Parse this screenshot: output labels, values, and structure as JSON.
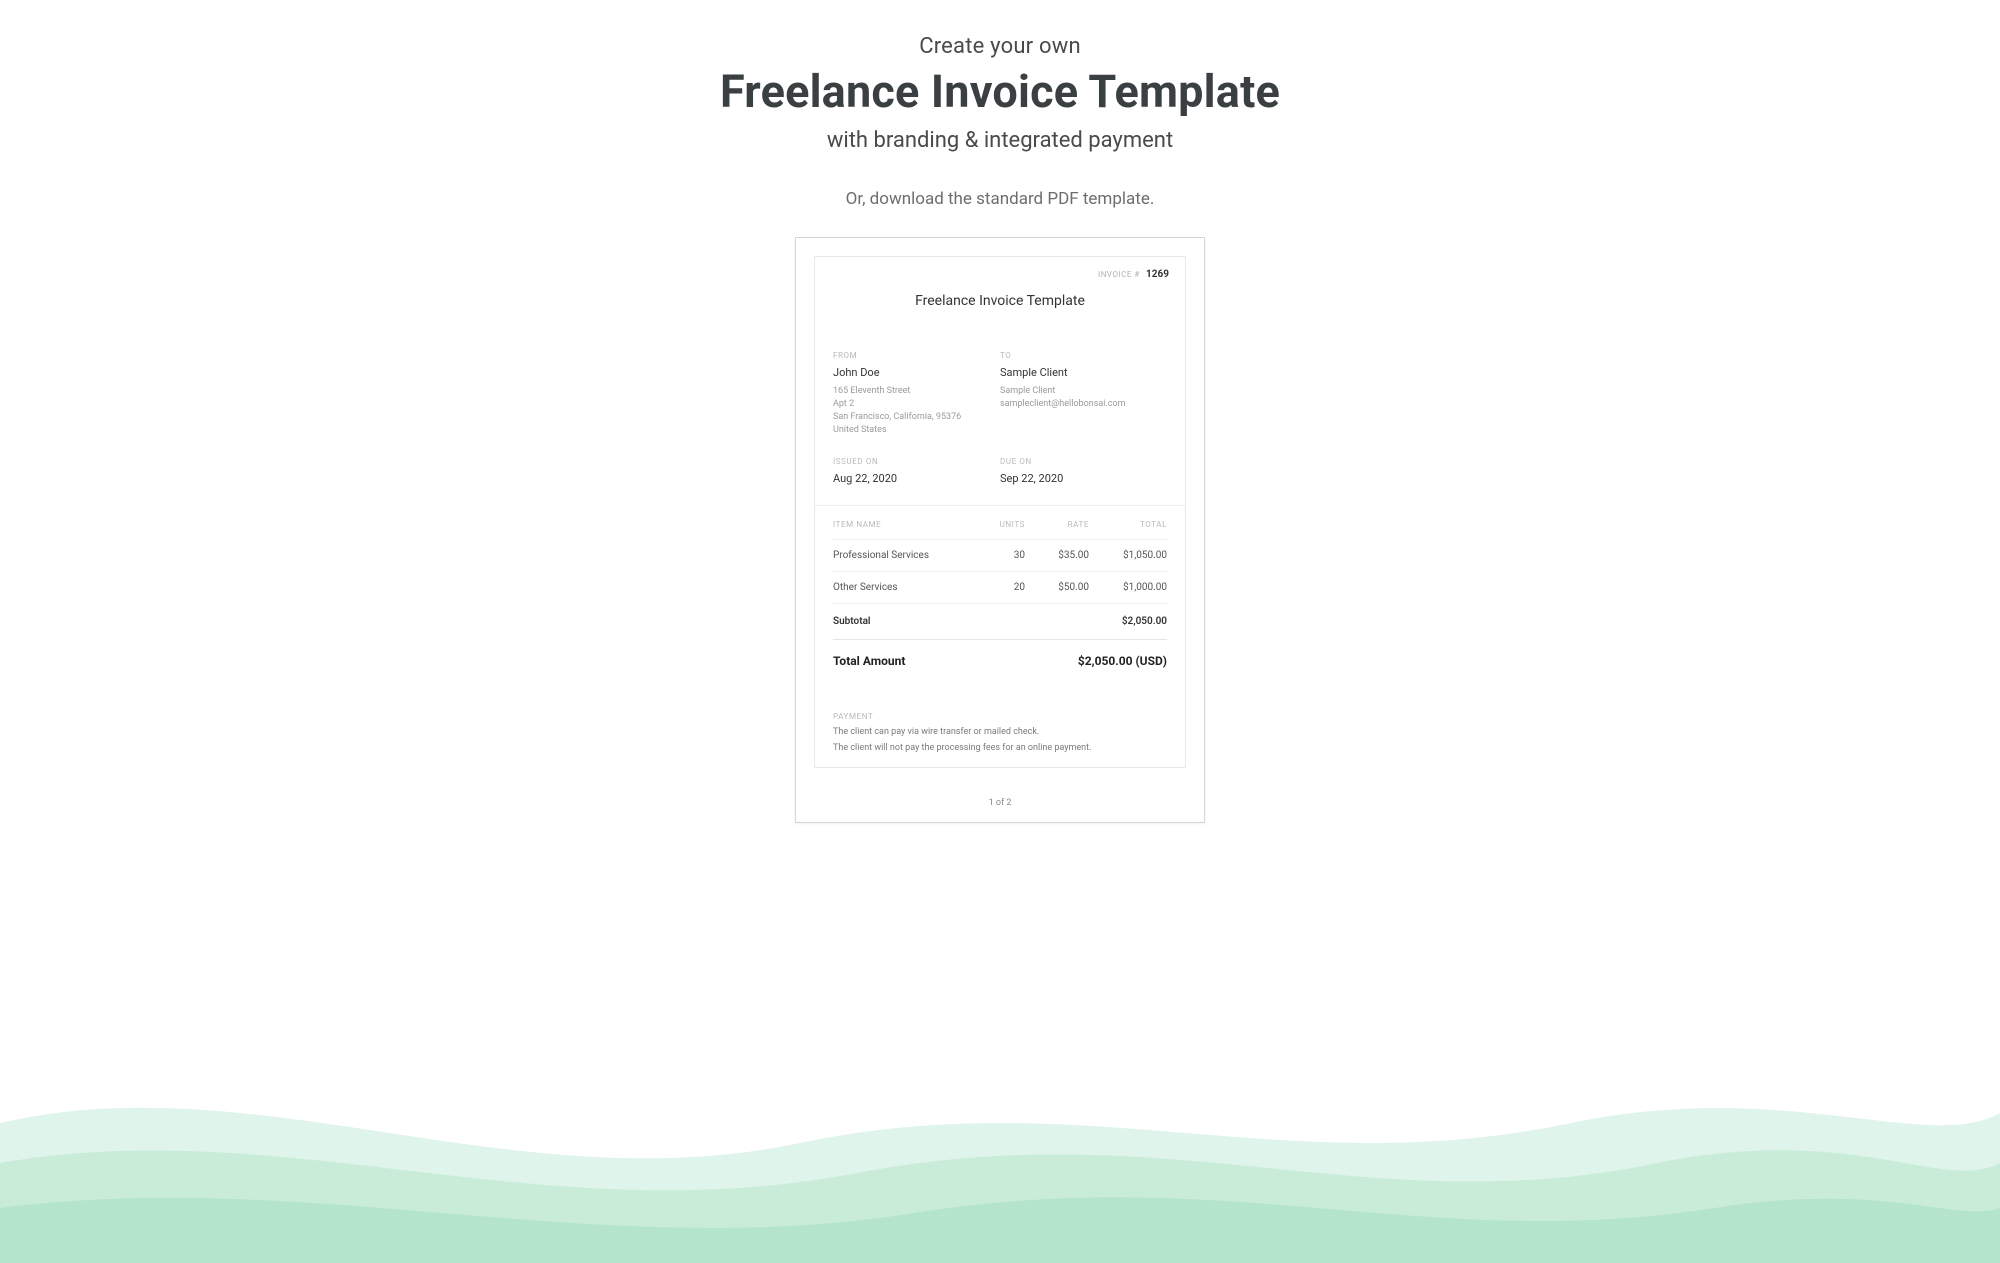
{
  "hero": {
    "line1": "Create your own",
    "line2": "Freelance Invoice Template",
    "line3": "with branding & integrated payment",
    "sub": "Or, download the standard PDF template."
  },
  "doc": {
    "invoice_label": "INVOICE #",
    "invoice_number": "1269",
    "title": "Freelance Invoice Template",
    "from_label": "FROM",
    "to_label": "TO",
    "from": {
      "name": "John Doe",
      "addr1": "165 Eleventh Street",
      "addr2": "Apt 2",
      "addr3": "San Francisco, California, 95376",
      "addr4": "United States"
    },
    "to": {
      "name": "Sample Client",
      "org": "Sample Client",
      "email": "sampleclient@hellobonsai.com"
    },
    "issued_label": "ISSUED ON",
    "issued_value": "Aug 22, 2020",
    "due_label": "DUE ON",
    "due_value": "Sep 22, 2020",
    "cols": {
      "item": "ITEM NAME",
      "units": "UNITS",
      "rate": "RATE",
      "total": "TOTAL"
    },
    "items": [
      {
        "name": "Professional Services",
        "units": "30",
        "rate": "$35.00",
        "total": "$1,050.00"
      },
      {
        "name": "Other Services",
        "units": "20",
        "rate": "$50.00",
        "total": "$1,000.00"
      }
    ],
    "subtotal_label": "Subtotal",
    "subtotal_value": "$2,050.00",
    "total_label": "Total Amount",
    "total_value": "$2,050.00 (USD)",
    "payment_label": "PAYMENT",
    "payment_line1": "The client can pay via wire transfer or mailed check.",
    "payment_line2": "The client will not pay the processing fees for an online payment.",
    "pager": "1 of 2"
  }
}
